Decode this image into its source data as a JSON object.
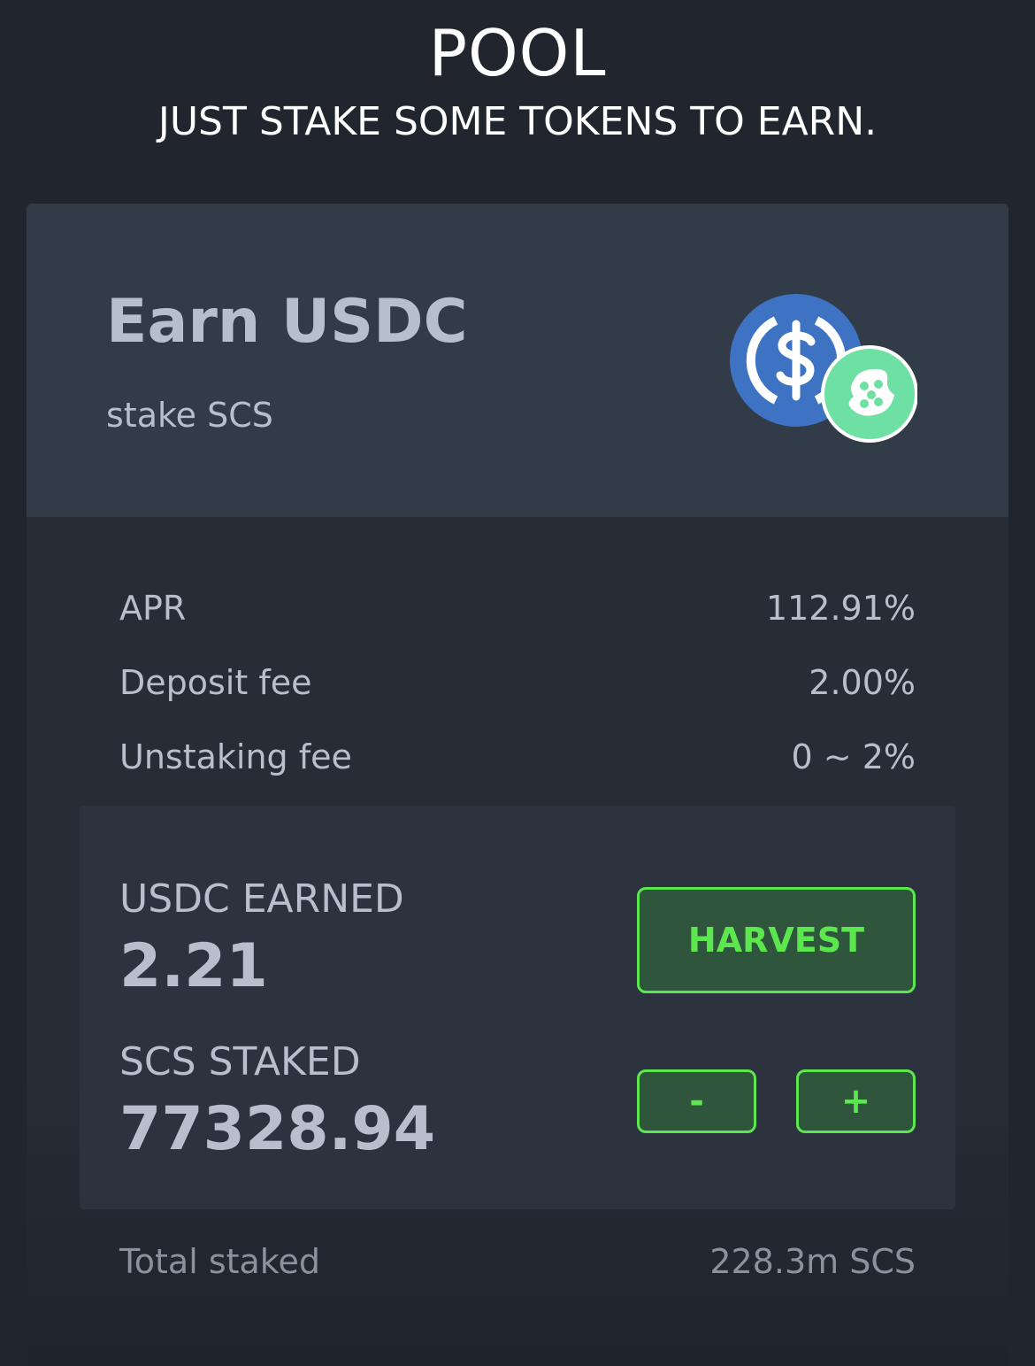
{
  "header": {
    "title": "POOL",
    "subtitle": "JUST STAKE SOME TOKENS TO EARN."
  },
  "pool": {
    "title": "Earn USDC",
    "subtitle": "stake SCS",
    "icons": {
      "primary": "usdc-coin-icon",
      "secondary": "scs-dice-token-icon",
      "primary_color": "#3e73c4",
      "secondary_color": "#6fe0a3"
    }
  },
  "stats": [
    {
      "label": "APR",
      "value": "112.91%"
    },
    {
      "label": "Deposit fee",
      "value": "2.00%"
    },
    {
      "label": "Unstaking fee",
      "value": "0 ~ 2%"
    }
  ],
  "earned": {
    "label": "USDC EARNED",
    "value": "2.21",
    "harvest_label": "HARVEST"
  },
  "staked": {
    "label": "SCS STAKED",
    "value": "77328.94",
    "minus_label": "-",
    "plus_label": "+"
  },
  "total": {
    "label": "Total staked",
    "value": "228.3m SCS"
  },
  "colors": {
    "background": "#20252e",
    "card_header": "#323b48",
    "accent_green": "#5be74d",
    "button_bg": "#2f553c",
    "text_muted": "#b8bfcc"
  }
}
